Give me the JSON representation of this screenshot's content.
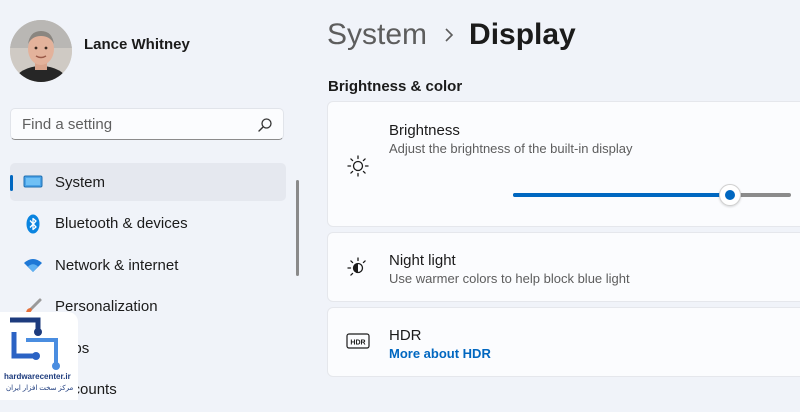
{
  "colors": {
    "accent": "#0067c0",
    "background": "#f0f3f9",
    "card": "#fbfcfe"
  },
  "user": {
    "name": "Lance Whitney",
    "avatar_icon": "user-avatar-photo"
  },
  "search": {
    "placeholder": "Find a setting",
    "value": "",
    "icon": "search-icon"
  },
  "sidebar": {
    "items": [
      {
        "label": "System",
        "icon": "monitor-icon",
        "selected": true
      },
      {
        "label": "Bluetooth & devices",
        "icon": "bluetooth-icon",
        "selected": false
      },
      {
        "label": "Network & internet",
        "icon": "wifi-icon",
        "selected": false
      },
      {
        "label": "Personalization",
        "icon": "brush-icon",
        "selected": false
      },
      {
        "label": "Apps",
        "icon": "apps-icon",
        "selected": false
      },
      {
        "label": "Accounts",
        "icon": "accounts-icon",
        "selected": false
      }
    ]
  },
  "breadcrumb": {
    "parent": "System",
    "current": "Display"
  },
  "section": {
    "title": "Brightness & color"
  },
  "cards": {
    "brightness": {
      "title": "Brightness",
      "description": "Adjust the brightness of the built-in display",
      "icon": "sun-icon",
      "slider_fraction": 0.78
    },
    "night_light": {
      "title": "Night light",
      "description": "Use warmer colors to help block blue light",
      "icon": "night-light-icon"
    },
    "hdr": {
      "title": "HDR",
      "link": "More about HDR",
      "icon": "hdr-icon"
    }
  },
  "watermark": {
    "brand": "hardwarecenter.ir",
    "subtitle": "مرکز سخت افزار ایران"
  }
}
